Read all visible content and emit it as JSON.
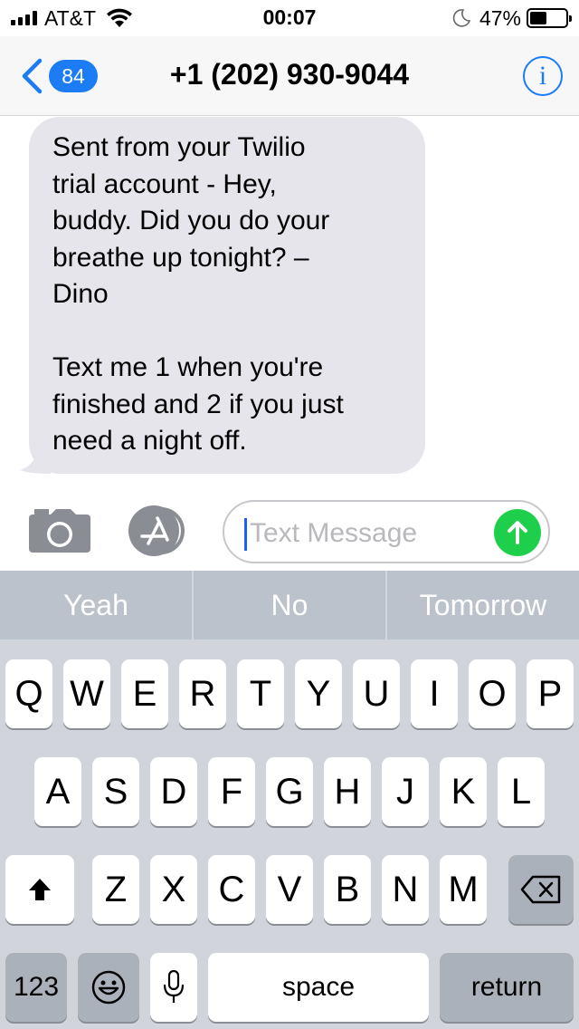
{
  "status_bar": {
    "carrier": "AT&T",
    "time": "00:07",
    "battery_percent": "47%",
    "battery_level": 0.47,
    "signal_bars": 4,
    "icons": [
      "signal-icon",
      "wifi-icon",
      "moon-icon",
      "battery-icon"
    ]
  },
  "nav": {
    "unread_count": "84",
    "title": "+1 (202) 930-9044",
    "info_label": "i",
    "accent_color": "#1c7cf6"
  },
  "messages": [
    {
      "direction": "incoming",
      "text": "Sent from your Twilio\ntrial account - Hey,\nbuddy. Did you do your\nbreathe up tonight? –\nDino\n\nText me 1 when you're\nfinished and 2 if you just\nneed a night off."
    }
  ],
  "composer": {
    "placeholder": "Text Message",
    "value": "",
    "send_color": "#1ecf4b"
  },
  "predictive": [
    "Yeah",
    "No",
    "Tomorrow"
  ],
  "keyboard": {
    "row1": [
      "Q",
      "W",
      "E",
      "R",
      "T",
      "Y",
      "U",
      "I",
      "O",
      "P"
    ],
    "row2": [
      "A",
      "S",
      "D",
      "F",
      "G",
      "H",
      "J",
      "K",
      "L"
    ],
    "row3": [
      "Z",
      "X",
      "C",
      "V",
      "B",
      "N",
      "M"
    ],
    "numbers_label": "123",
    "space_label": "space",
    "return_label": "return"
  }
}
